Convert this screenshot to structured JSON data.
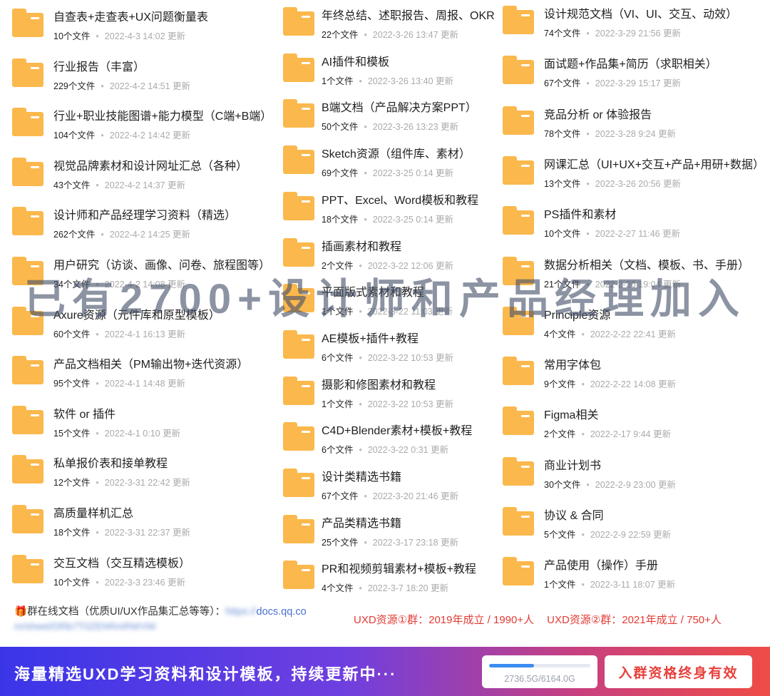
{
  "columns": [
    [
      {
        "name": "自查表+走查表+UX问题衡量表",
        "count": "10个文件",
        "date": "2022-4-3 14:02 更新"
      },
      {
        "name": "行业报告（丰富）",
        "count": "229个文件",
        "date": "2022-4-2 14:51 更新"
      },
      {
        "name": "行业+职业技能图谱+能力模型（C端+B端）",
        "count": "104个文件",
        "date": "2022-4-2 14:42 更新"
      },
      {
        "name": "视觉品牌素材和设计网址汇总（各种）",
        "count": "43个文件",
        "date": "2022-4-2 14:37 更新"
      },
      {
        "name": "设计师和产品经理学习资料（精选）",
        "count": "262个文件",
        "date": "2022-4-2 14:25 更新"
      },
      {
        "name": "用户研究（访谈、画像、问卷、旅程图等）",
        "count": "34个文件",
        "date": "2022-4-2 14:08 更新"
      },
      {
        "name": "Axure资源（元件库和原型模板）",
        "count": "60个文件",
        "date": "2022-4-1 16:13 更新"
      },
      {
        "name": "产品文档相关（PM输出物+迭代资源）",
        "count": "95个文件",
        "date": "2022-4-1 14:48 更新"
      },
      {
        "name": "软件 or 插件",
        "count": "15个文件",
        "date": "2022-4-1 0:10 更新"
      },
      {
        "name": "私单报价表和接单教程",
        "count": "12个文件",
        "date": "2022-3-31 22:42 更新"
      },
      {
        "name": "高质量样机汇总",
        "count": "18个文件",
        "date": "2022-3-31 22:37 更新"
      },
      {
        "name": "交互文档（交互精选模板）",
        "count": "10个文件",
        "date": "2022-3-3 23:46 更新"
      }
    ],
    [
      {
        "name": "年终总结、述职报告、周报、OKR",
        "count": "22个文件",
        "date": "2022-3-26 13:47 更新"
      },
      {
        "name": "AI插件和模板",
        "count": "1个文件",
        "date": "2022-3-26 13:40 更新"
      },
      {
        "name": "B端文档（产品解决方案PPT）",
        "count": "50个文件",
        "date": "2022-3-26 13:23 更新"
      },
      {
        "name": "Sketch资源（组件库、素材）",
        "count": "69个文件",
        "date": "2022-3-25 0:14 更新"
      },
      {
        "name": "PPT、Excel、Word模板和教程",
        "count": "18个文件",
        "date": "2022-3-25 0:14 更新"
      },
      {
        "name": "插画素材和教程",
        "count": "2个文件",
        "date": "2022-3-22 12:06 更新"
      },
      {
        "name": "平面版式素材和教程",
        "count": "1个文件",
        "date": "2022-3-22 11:03 更新"
      },
      {
        "name": "AE模板+插件+教程",
        "count": "6个文件",
        "date": "2022-3-22 10:53 更新"
      },
      {
        "name": "摄影和修图素材和教程",
        "count": "1个文件",
        "date": "2022-3-22 10:53 更新"
      },
      {
        "name": "C4D+Blender素材+模板+教程",
        "count": "6个文件",
        "date": "2022-3-22 0:31 更新"
      },
      {
        "name": "设计类精选书籍",
        "count": "67个文件",
        "date": "2022-3-20 21:46 更新"
      },
      {
        "name": "产品类精选书籍",
        "count": "25个文件",
        "date": "2022-3-17 23:18 更新"
      },
      {
        "name": "PR和视频剪辑素材+模板+教程",
        "count": "4个文件",
        "date": "2022-3-7 18:20 更新"
      }
    ],
    [
      {
        "name": "设计规范文档（VI、UI、交互、动效）",
        "count": "74个文件",
        "date": "2022-3-29 21:56 更新"
      },
      {
        "name": "面试题+作品集+简历（求职相关）",
        "count": "67个文件",
        "date": "2022-3-29 15:17 更新"
      },
      {
        "name": "竞品分析 or 体验报告",
        "count": "78个文件",
        "date": "2022-3-28 9:24 更新"
      },
      {
        "name": "网课汇总（UI+UX+交互+产品+用研+数据）",
        "count": "13个文件",
        "date": "2022-3-26 20:56 更新"
      },
      {
        "name": "PS插件和素材",
        "count": "10个文件",
        "date": "2022-2-27 11:46 更新"
      },
      {
        "name": "数据分析相关（文档、模板、书、手册）",
        "count": "21个文件",
        "date": "2022-2-26 19:04 更新"
      },
      {
        "name": "Principle资源",
        "count": "4个文件",
        "date": "2022-2-22 22:41 更新"
      },
      {
        "name": "常用字体包",
        "count": "9个文件",
        "date": "2022-2-22 14:08 更新"
      },
      {
        "name": "Figma相关",
        "count": "2个文件",
        "date": "2022-2-17 9:44 更新"
      },
      {
        "name": "商业计划书",
        "count": "30个文件",
        "date": "2022-2-9 23:00 更新"
      },
      {
        "name": "协议 & 合同",
        "count": "5个文件",
        "date": "2022-2-9 22:59 更新"
      },
      {
        "name": "产品使用（操作）手册",
        "count": "1个文件",
        "date": "2022-3-11 18:07 更新"
      }
    ]
  ],
  "watermark": "已有2700+设计师和产品经理加入",
  "info": {
    "gift_icon": "🎁",
    "prefix": "群在线文档（优质UI/UX作品集汇总等等）：",
    "link_blur": "https://",
    "link": "docs.qq.co",
    "link_line2": "m/sheet/DRb7T0ZEhRmRWVW"
  },
  "groups": [
    "UXD资源①群：2019年成立 / 1990+人",
    "UXD资源②群：2021年成立 / 750+人"
  ],
  "banner": {
    "text": "海量精选UXD学习资料和设计模板，持续更新中···",
    "storage_text": "2736.5G/6164.0G",
    "storage_fraction": 0.444,
    "join_label": "入群资格终身有效"
  }
}
